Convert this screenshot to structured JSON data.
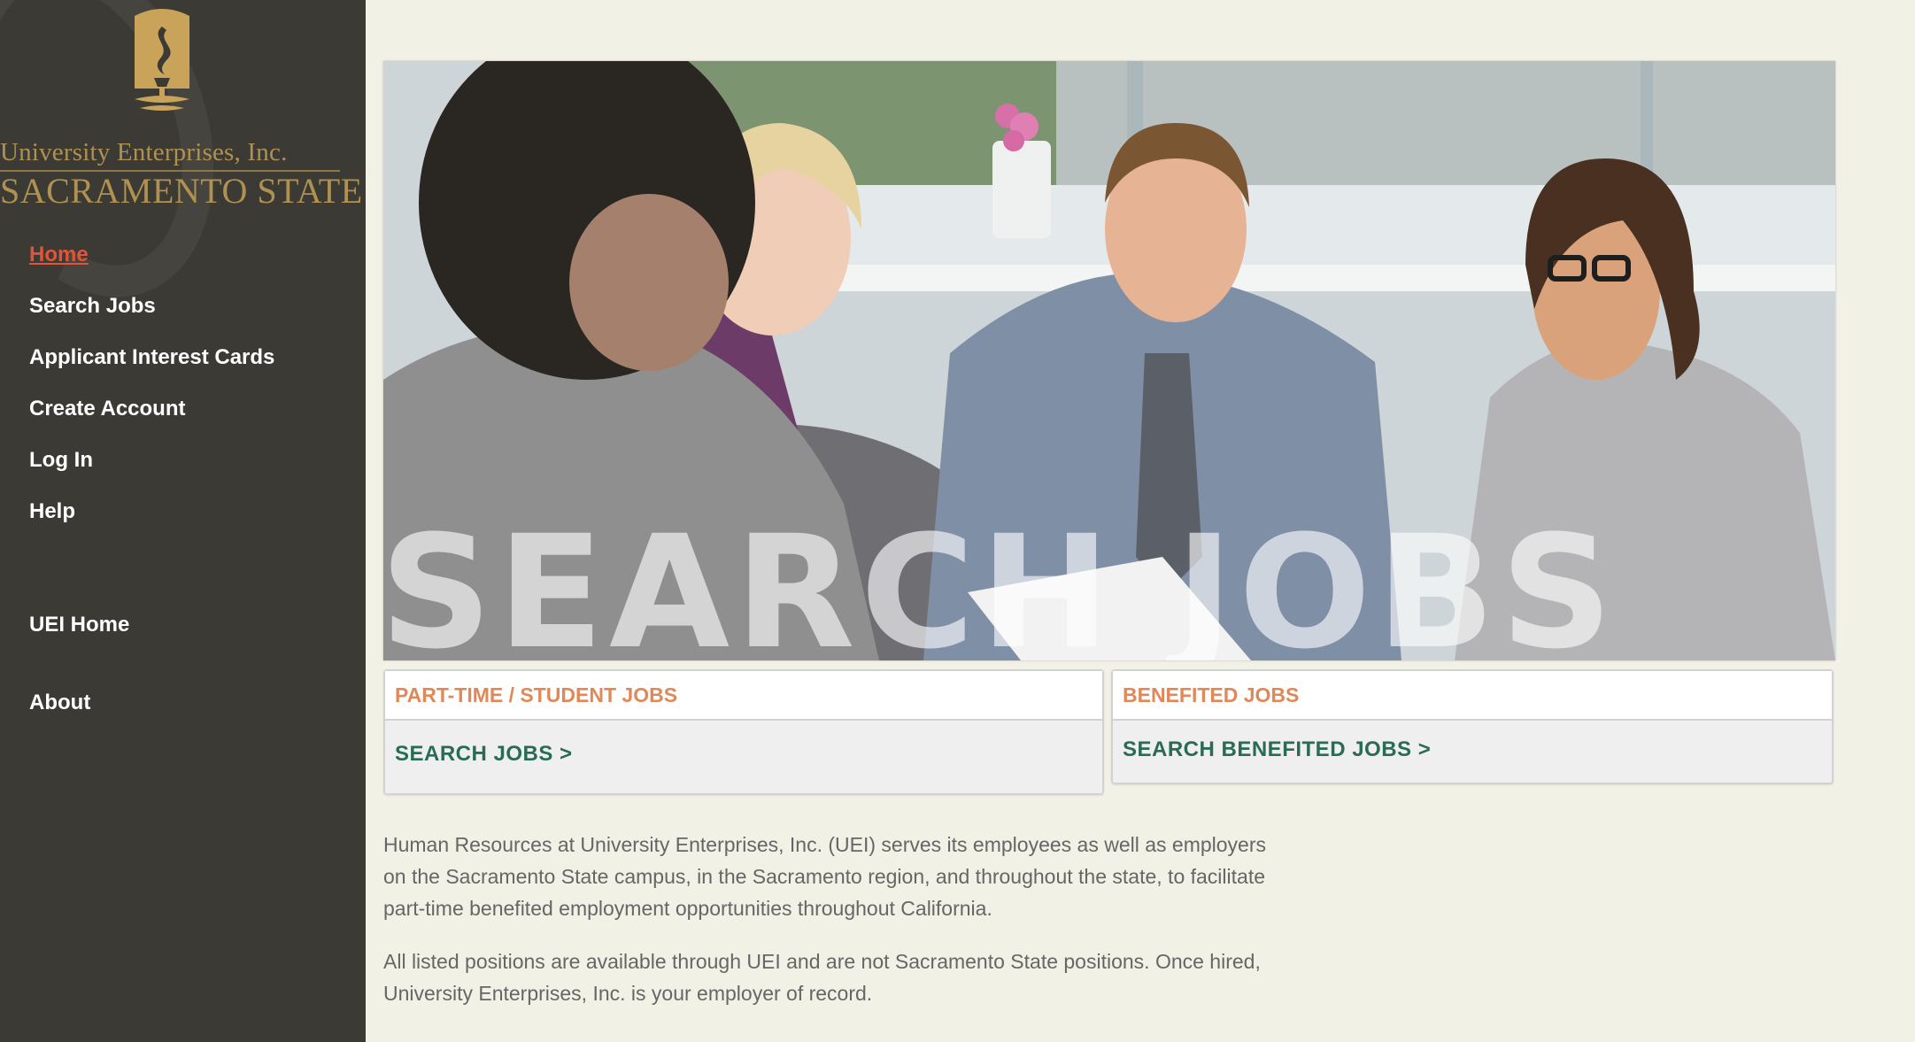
{
  "logo": {
    "line1": "University Enterprises, Inc.",
    "line2": "SACRAMENTO STATE",
    "icon": "torch-flame-icon"
  },
  "nav": {
    "items": [
      {
        "label": "Home",
        "active": true
      },
      {
        "label": "Search Jobs",
        "active": false
      },
      {
        "label": "Applicant Interest Cards",
        "active": false
      },
      {
        "label": "Create Account",
        "active": false
      },
      {
        "label": "Log In",
        "active": false
      },
      {
        "label": "Help",
        "active": false
      }
    ],
    "secondary": [
      {
        "label": "UEI Home"
      },
      {
        "label": "About"
      }
    ]
  },
  "hero": {
    "title": "SEARCH JOBS"
  },
  "cards": [
    {
      "header": "PART-TIME / STUDENT JOBS",
      "link": "SEARCH JOBS >"
    },
    {
      "header": "BENEFITED JOBS",
      "link": "SEARCH BENEFITED JOBS >"
    }
  ],
  "intro": {
    "paragraph1": "Human Resources at University Enterprises, Inc. (UEI) serves its employees as well as employers on the Sacramento State campus, in the Sacramento region, and throughout the state, to facilitate part-time benefited employment opportunities throughout California.",
    "paragraph2": "All listed positions are available through UEI and are not Sacramento State positions. Once hired, University Enterprises, Inc. is your employer of record."
  },
  "colors": {
    "sidebar": "#3b3a35",
    "page_background": "#f2f1e6",
    "active_link": "#e0553a",
    "card_header": "#e08858",
    "card_link": "#2a6b58",
    "logo_gold": "#b0914f"
  }
}
